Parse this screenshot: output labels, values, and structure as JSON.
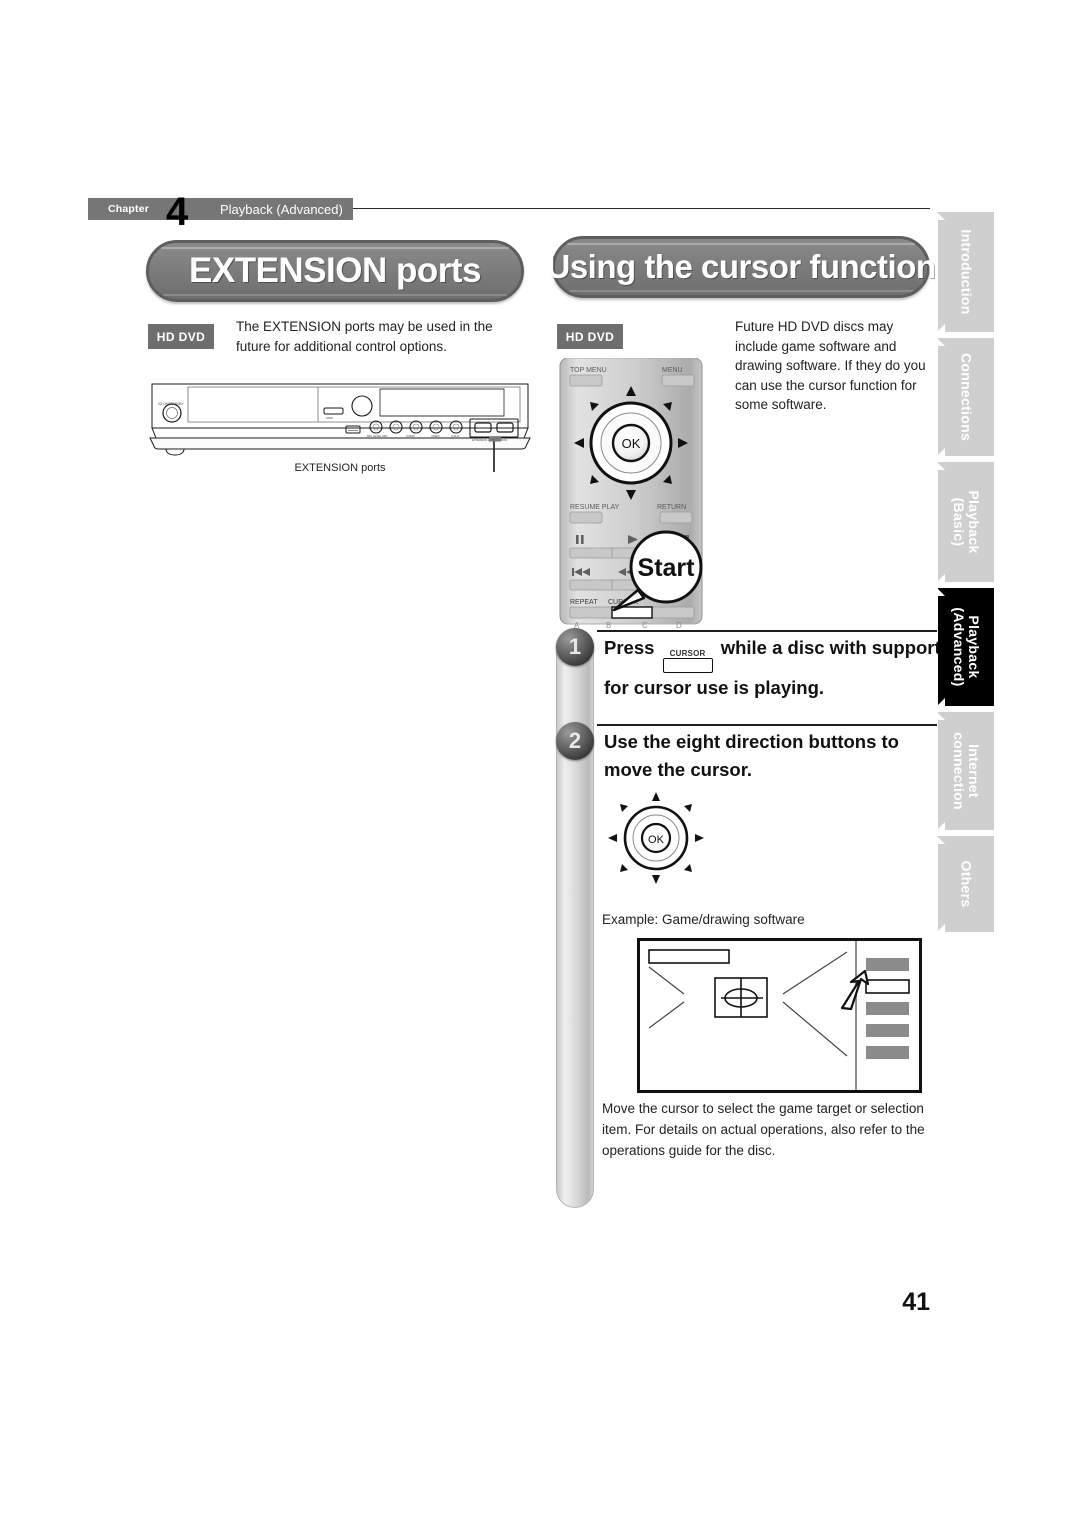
{
  "document": {
    "page_number": "41",
    "chapter": {
      "word": "Chapter",
      "number": "4",
      "name": "Playback (Advanced)"
    }
  },
  "sections": {
    "left": {
      "title": "EXTENSION ports",
      "badge": "HD DVD",
      "body": "The EXTENSION ports may be used in the future for additional control options.",
      "figure_caption": "EXTENSION ports"
    },
    "right": {
      "title": "Using the cursor function",
      "badge": "HD DVD",
      "body": "Future HD DVD discs may include game software and drawing software. If they do you can use the cursor function for some software.",
      "remote": {
        "callout": "Start",
        "buttons": {
          "top_menu": "TOP MENU",
          "menu": "MENU",
          "ok": "OK",
          "resume_play": "RESUME PLAY",
          "return": "RETURN",
          "repeat": "REPEAT",
          "cursor": "CURSOR",
          "color_a": "A",
          "color_b": "B",
          "color_c": "C",
          "color_d": "D"
        }
      },
      "steps": [
        {
          "number": "1",
          "text_before": "Press",
          "key_label": "CURSOR",
          "text_after": "while a disc with support for cursor use is playing."
        },
        {
          "number": "2",
          "text": "Use the eight direction buttons to move the cursor."
        }
      ],
      "dpad_center_label": "OK",
      "example_caption": "Example: Game/drawing software",
      "closing_body": "Move the cursor to select the game target or selection item. For details on actual operations, also refer to the operations guide for the disc."
    }
  },
  "index_tabs": [
    {
      "label": "Introduction",
      "active": false
    },
    {
      "label": "Connections",
      "active": false
    },
    {
      "label": "Playback\n(Basic)",
      "active": false
    },
    {
      "label": "Playback\n(Advanced)",
      "active": true
    },
    {
      "label": "Internet\nconnection",
      "active": false
    },
    {
      "label": "Others",
      "active": false
    }
  ],
  "colors": {
    "title_pill": "#7d7d7d",
    "badge": "#6e6e6e",
    "chapter_bar": "#767676",
    "tab_inactive": "#cfcfcf",
    "tab_active": "#000000",
    "text": "#222222"
  }
}
